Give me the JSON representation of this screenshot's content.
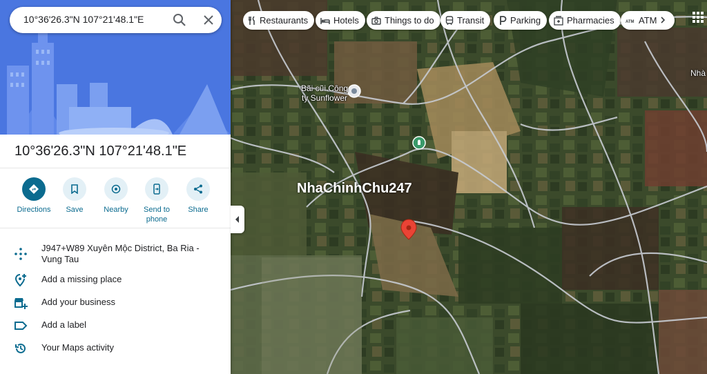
{
  "search": {
    "value": "10°36'26.3\"N 107°21'48.1\"E"
  },
  "place": {
    "title": "10°36'26.3\"N 107°21'48.1\"E"
  },
  "actions": [
    {
      "label": "Directions",
      "icon": "directions-icon"
    },
    {
      "label": "Save",
      "icon": "bookmark-icon"
    },
    {
      "label": "Nearby",
      "icon": "nearby-icon"
    },
    {
      "label": "Send to phone",
      "label_lines": [
        "Send to",
        "phone"
      ],
      "icon": "phone-icon"
    },
    {
      "label": "Share",
      "icon": "share-icon"
    }
  ],
  "info_rows": [
    {
      "icon": "plus-code-icon",
      "text": "J947+W89 Xuyên Mộc District, Ba Ria - Vung Tau"
    },
    {
      "icon": "add-location-icon",
      "text": "Add a missing place"
    },
    {
      "icon": "add-business-icon",
      "text": "Add your business"
    },
    {
      "icon": "label-icon",
      "text": "Add a label"
    },
    {
      "icon": "history-icon",
      "text": "Your Maps activity"
    }
  ],
  "map": {
    "chips": [
      {
        "label": "Restaurants",
        "icon": "restaurant-icon"
      },
      {
        "label": "Hotels",
        "icon": "hotel-icon"
      },
      {
        "label": "Things to do",
        "icon": "camera-icon"
      },
      {
        "label": "Transit",
        "icon": "transit-icon"
      },
      {
        "label": "Parking",
        "icon": "parking-icon"
      },
      {
        "label": "Pharmacies",
        "icon": "pharmacy-icon"
      },
      {
        "label": "ATM",
        "icon": "atm-icon"
      }
    ],
    "poi_label_lines": [
      "Bãi cũi Công",
      "ty Sunflower"
    ],
    "edge_label": "Nhà",
    "watermark": "NhaChinhChu247",
    "colors": {
      "accent": "#0b6b8f",
      "pin": "#ea4335",
      "hero": "#4a76e0"
    }
  }
}
